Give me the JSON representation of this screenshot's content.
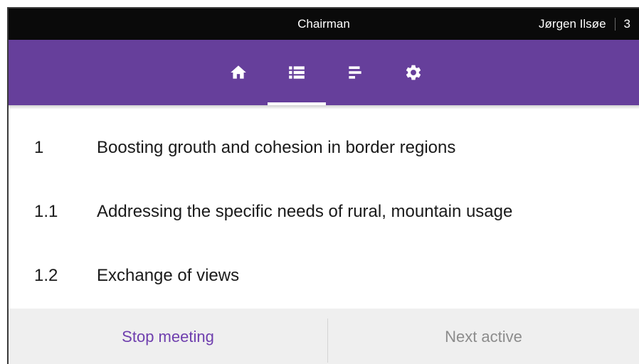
{
  "header": {
    "role": "Chairman",
    "user_name": "Jørgen Ilsøe",
    "user_count": "3"
  },
  "nav": {
    "tabs": [
      {
        "icon": "home-icon",
        "active": false
      },
      {
        "icon": "list-icon",
        "active": true
      },
      {
        "icon": "bar-chart-icon",
        "active": false
      },
      {
        "icon": "gear-icon",
        "active": false
      }
    ]
  },
  "agenda": {
    "items": [
      {
        "number": "1",
        "title": "Boosting grouth and cohesion in border regions"
      },
      {
        "number": "1.1",
        "title": "Addressing the specific needs of rural, mountain usage"
      },
      {
        "number": "1.2",
        "title": "Exchange of views"
      }
    ]
  },
  "footer": {
    "stop_label": "Stop meeting",
    "next_label": "Next active"
  },
  "colors": {
    "topbar": "#0a0a0a",
    "navbar": "#663f9b",
    "accent": "#6f3fae",
    "disabled": "#8c8c8c",
    "footer_bg": "#efefef"
  }
}
